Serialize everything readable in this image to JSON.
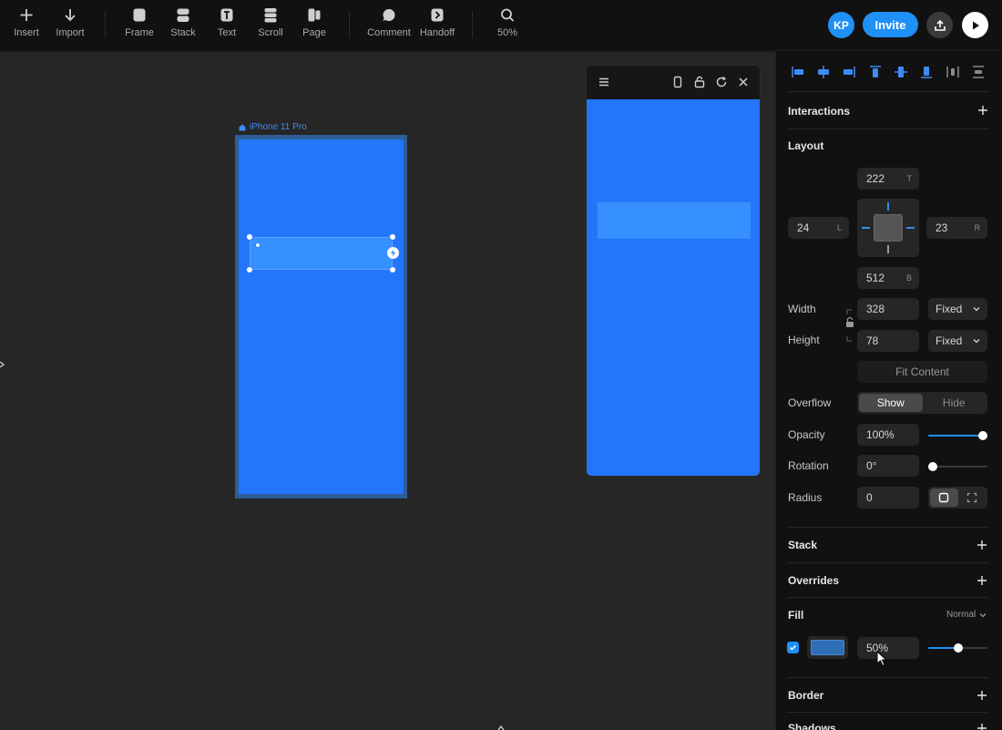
{
  "toolbar": {
    "left_tools": [
      {
        "label": "Insert",
        "icon": "plus-icon"
      },
      {
        "label": "Import",
        "icon": "arrow-down-icon"
      }
    ],
    "layer_tools": [
      {
        "label": "Frame",
        "icon": "frame-icon"
      },
      {
        "label": "Stack",
        "icon": "stack-icon"
      },
      {
        "label": "Text",
        "icon": "text-icon"
      },
      {
        "label": "Scroll",
        "icon": "scroll-icon"
      },
      {
        "label": "Page",
        "icon": "page-icon"
      }
    ],
    "collab_tools": [
      {
        "label": "Comment",
        "icon": "comment-icon"
      },
      {
        "label": "Handoff",
        "icon": "handoff-icon"
      }
    ],
    "zoom": {
      "label": "50%",
      "icon": "search-icon"
    },
    "avatar_initials": "KP",
    "invite_label": "Invite",
    "publish_icon": "upload-icon",
    "play_icon": "play-icon"
  },
  "canvas": {
    "frame_label": "iPhone 11 Pro",
    "device_color": "#2376f9",
    "selected_color": "#3690ff"
  },
  "panel": {
    "sections": {
      "interactions": "Interactions",
      "layout": "Layout",
      "stack": "Stack",
      "overrides": "Overrides",
      "fill": "Fill",
      "border": "Border",
      "shadows": "Shadows"
    },
    "position": {
      "top": {
        "value": "222",
        "suffix": "T"
      },
      "left": {
        "value": "24",
        "suffix": "L"
      },
      "right": {
        "value": "23",
        "suffix": "R"
      },
      "bottom": {
        "value": "512",
        "suffix": "B"
      }
    },
    "width": {
      "label": "Width",
      "value": "328",
      "mode": "Fixed"
    },
    "height": {
      "label": "Height",
      "value": "78",
      "mode": "Fixed"
    },
    "fit_content": "Fit Content",
    "overflow": {
      "label": "Overflow",
      "options": [
        "Show",
        "Hide"
      ],
      "selected": "Show"
    },
    "opacity": {
      "label": "Opacity",
      "value": "100%",
      "level": 1.0
    },
    "rotation": {
      "label": "Rotation",
      "value": "0°",
      "level": 0.0
    },
    "radius": {
      "label": "Radius",
      "value": "0"
    },
    "fill": {
      "blend": "Normal",
      "enabled": true,
      "color": "#2f6fb8",
      "opacity": "50%",
      "level": 0.5
    }
  },
  "accent": "#1f90f5"
}
